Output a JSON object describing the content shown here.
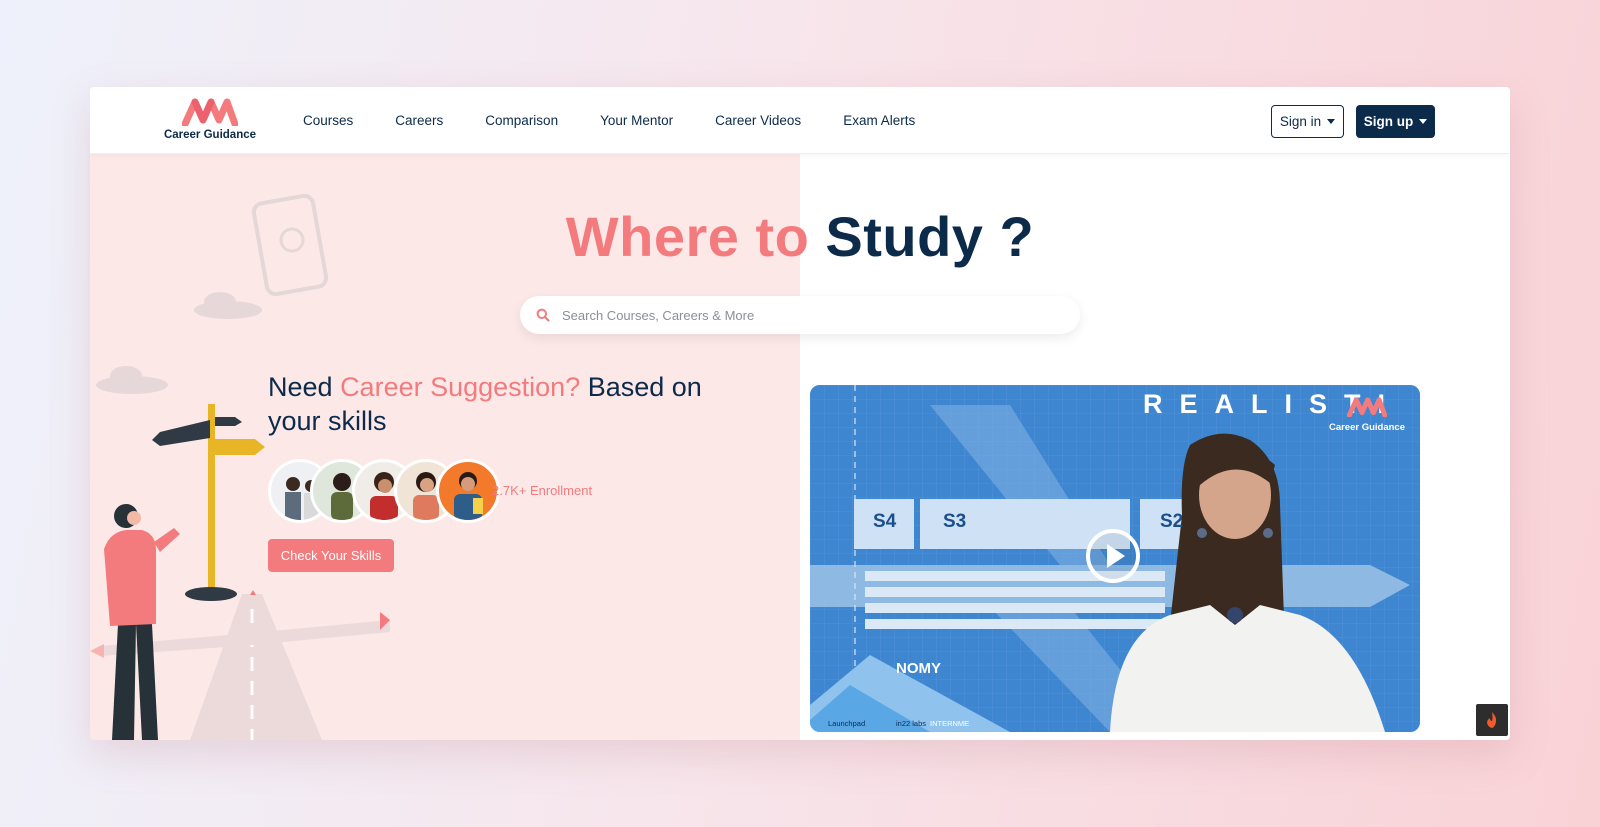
{
  "brand": {
    "name": "Career Guidance"
  },
  "nav": {
    "items": [
      "Courses",
      "Careers",
      "Comparison",
      "Your Mentor",
      "Career Videos",
      "Exam Alerts"
    ],
    "sign_in": "Sign in",
    "sign_up": "Sign up"
  },
  "hero": {
    "title_accent": "Where to ",
    "title_main": "Study ?",
    "search_placeholder": "Search Courses, Careers & More"
  },
  "career": {
    "head_1": "Need ",
    "head_accent": "Career Suggestion?",
    "head_2": " Based on your skills",
    "enrollment": "2.7K+ Enrollment",
    "cta": "Check Your Skills"
  },
  "video": {
    "overlay_word": "REALISTI",
    "brand": "Career Guidance",
    "seats": [
      "S4",
      "S3",
      "S2"
    ],
    "partial_word": "NOMY",
    "sponsor_1": "Launchpad",
    "sponsor_2": "in22 labs",
    "sponsor_3": "INTERNME"
  },
  "colors": {
    "navy": "#0c2a4a",
    "coral": "#f37b7e",
    "hero_left": "#fde8e8"
  }
}
